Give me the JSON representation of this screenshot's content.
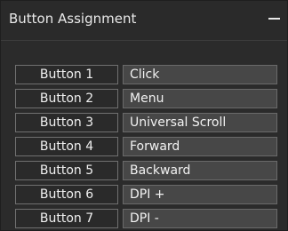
{
  "panel": {
    "title": "Button Assignment",
    "collapse_icon": "minus-icon"
  },
  "assignments": [
    {
      "button": "Button 1",
      "function": "Click"
    },
    {
      "button": "Button 2",
      "function": "Menu"
    },
    {
      "button": "Button 3",
      "function": "Universal Scroll"
    },
    {
      "button": "Button 4",
      "function": "Forward"
    },
    {
      "button": "Button 5",
      "function": "Backward"
    },
    {
      "button": "Button 6",
      "function": "DPI +"
    },
    {
      "button": "Button 7",
      "function": "DPI -"
    }
  ],
  "colors": {
    "background": "#2b2b2b",
    "field_fill": "#474747",
    "text": "#f0f0f0"
  }
}
